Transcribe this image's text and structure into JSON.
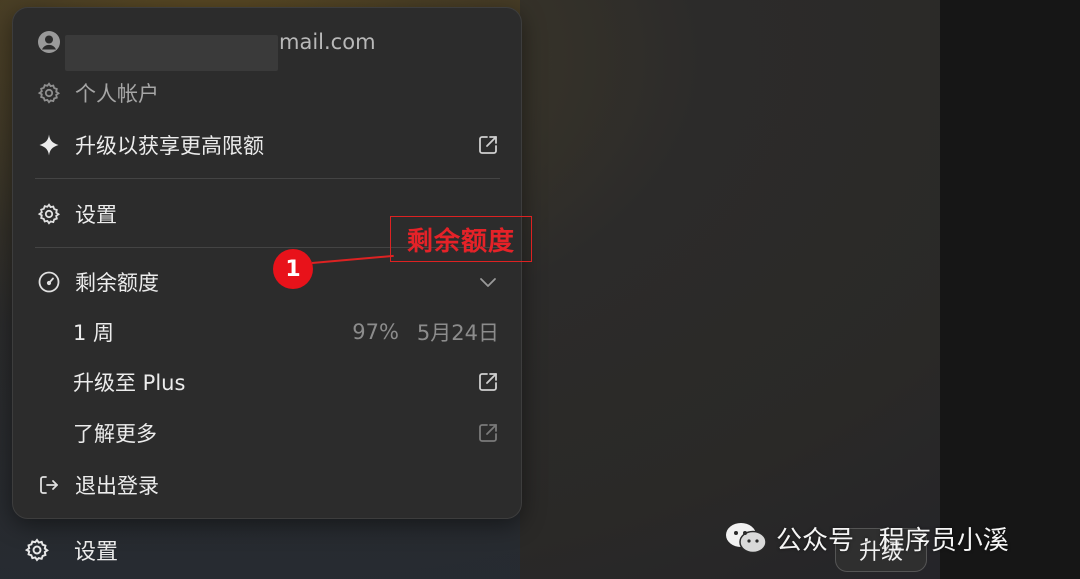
{
  "account": {
    "email_suffix": "mail.com"
  },
  "menu": {
    "personal_account": "个人帐户",
    "upgrade_limit": "升级以获享更高限额",
    "settings": "设置",
    "remaining_quota": "剩余额度",
    "week_label": "1 周",
    "week_percent": "97%",
    "week_reset_date": "5月24日",
    "upgrade_plus": "升级至 Plus",
    "learn_more": "了解更多",
    "logout": "退出登录"
  },
  "annotation": {
    "badge": "1",
    "label": "剩余额度"
  },
  "footer": {
    "settings": "设置",
    "upgrade": "升级"
  },
  "watermark": {
    "channel": "公众号 · 程序员小溪"
  }
}
